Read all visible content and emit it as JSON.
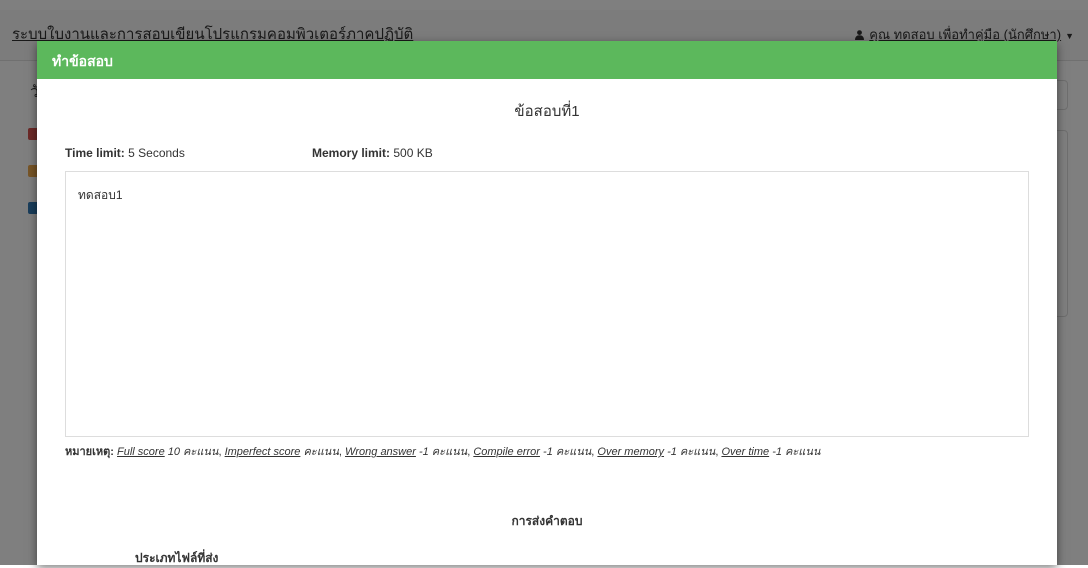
{
  "background": {
    "brand": "ระบบใบงานและการสอบเขียนโปรแกรมคอมพิวเตอร์ภาคปฏิบัติ",
    "user": "คุณ ทดสอบ เพื่อทำคู่มือ (นักศึกษา)",
    "side_char": "วั",
    "icons": [
      "home-icon",
      "users-icon",
      "book-icon"
    ],
    "person_icon": "user-icon",
    "caret_icon": "caret-down-icon"
  },
  "modal": {
    "title": "ทำข้อสอบ",
    "question_title": "ข้อสอบที่1",
    "time_limit_label": "Time limit:",
    "time_limit_value": "5 Seconds",
    "memory_limit_label": "Memory limit:",
    "memory_limit_value": "500 KB",
    "problem_text": "ทดสอบ1",
    "remark": {
      "label": "หมายเหตุ:",
      "items": [
        {
          "term": "Full score",
          "points": "10 คะแนน"
        },
        {
          "term": "Imperfect score",
          "points": "คะแนน"
        },
        {
          "term": "Wrong answer",
          "points": "-1 คะแนน"
        },
        {
          "term": "Compile error",
          "points": "-1 คะแนน"
        },
        {
          "term": "Over memory",
          "points": "-1 คะแนน"
        },
        {
          "term": "Over time",
          "points": "-1 คะแนน"
        }
      ]
    },
    "submit_title": "การส่งคำตอบ",
    "file_type_label": "ประเภทไฟล์ที่ส่ง"
  },
  "colors": {
    "header_green": "#5cb85c",
    "overlay": "rgba(0,0,0,0.5)",
    "icon_home": "#d9534f",
    "icon_users": "#f0ad4e",
    "icon_book": "#337ab7"
  }
}
